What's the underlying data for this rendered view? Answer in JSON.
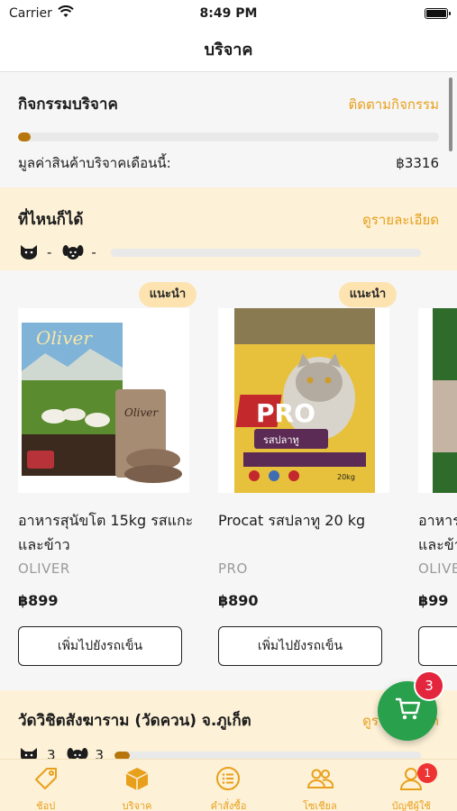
{
  "status_bar": {
    "carrier": "Carrier",
    "time": "8:49 PM"
  },
  "nav": {
    "title": "บริจาค"
  },
  "activity": {
    "title": "กิจกรรมบริจาค",
    "follow_link": "ติดตามกิจกรรม",
    "progress": 0.03,
    "value_label": "มูลค่าสินค้าบริจาคเดือนนี้:",
    "value": "฿3316"
  },
  "anywhere": {
    "title": "ที่ไหนก็ได้",
    "details_link": "ดูรายละเอียด",
    "cat_count": "-",
    "dog_count": "-",
    "progress": 0.0
  },
  "products": [
    {
      "badge": "แนะนำ",
      "name": "อาหารสุนัขโต 15kg รสแกะและข้าว",
      "brand": "OLIVER",
      "price": "฿899",
      "button": "เพิ่มไปยังรถเข็น"
    },
    {
      "badge": "แนะนำ",
      "name": "Procat รสปลาทู 20 kg",
      "brand": "PRO",
      "price": "฿890",
      "button": "เพิ่มไปยังรถเข็น"
    },
    {
      "badge": "",
      "name": "อาหาร\nและข้า",
      "brand": "OLIVE",
      "price": "฿99",
      "button": ""
    }
  ],
  "temple": {
    "title": "วัดวิชิตสังฆาราม (วัดควน) จ.ภูเก็ต",
    "details_link": "ดูรายละเอียด",
    "cat_count": "3",
    "dog_count": "3",
    "progress": 0.05
  },
  "cart": {
    "count": "3"
  },
  "tabs": [
    {
      "label": "ช้อป",
      "icon": "tag-icon"
    },
    {
      "label": "บริจาค",
      "icon": "box-icon"
    },
    {
      "label": "คำสั่งซื้อ",
      "icon": "list-icon"
    },
    {
      "label": "โซเชียล",
      "icon": "people-icon"
    },
    {
      "label": "บัญชีผู้ใช้",
      "icon": "person-icon",
      "badge": "1"
    }
  ],
  "colors": {
    "accent": "#e8a01c",
    "cream": "#fdf1d7",
    "progress": "#b7760a",
    "fab": "#29a04c",
    "badge": "#e3263d"
  }
}
